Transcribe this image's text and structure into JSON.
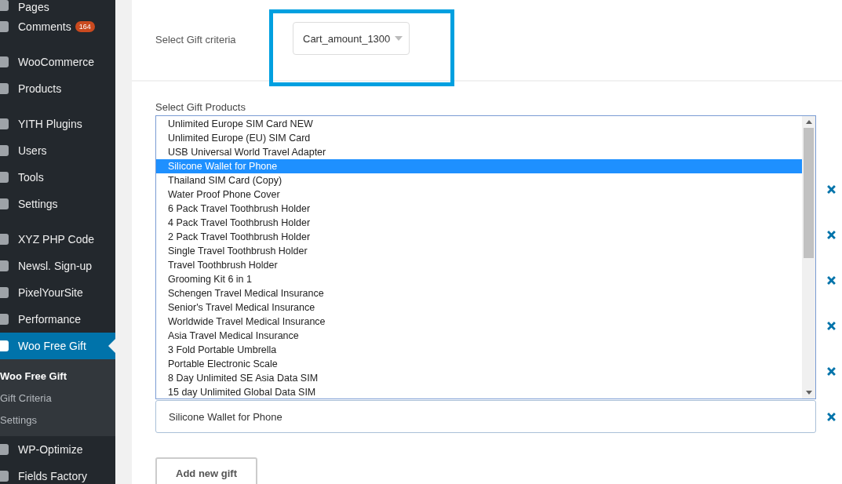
{
  "sidebar": {
    "groups": [
      {
        "items": [
          {
            "label": "Pages",
            "active": false
          },
          {
            "label": "Comments",
            "active": false,
            "badge": "164"
          }
        ]
      },
      {
        "items": [
          {
            "label": "WooCommerce",
            "active": false
          },
          {
            "label": "Products",
            "active": false
          }
        ]
      },
      {
        "items": [
          {
            "label": "YITH Plugins",
            "active": false
          },
          {
            "label": "Users",
            "active": false
          },
          {
            "label": "Tools",
            "active": false
          },
          {
            "label": "Settings",
            "active": false
          }
        ]
      },
      {
        "items": [
          {
            "label": "XYZ PHP Code",
            "active": false
          },
          {
            "label": "Newsl. Sign-up",
            "active": false
          },
          {
            "label": "PixelYourSite",
            "active": false
          },
          {
            "label": "Performance",
            "active": false
          },
          {
            "label": "Woo Free Gift",
            "selected": true,
            "submenu": [
              {
                "label": "Woo Free Gift",
                "selected": true
              },
              {
                "label": "Gift Criteria",
                "selected": false
              },
              {
                "label": "Settings",
                "selected": false
              }
            ]
          },
          {
            "label": "WP-Optimize",
            "active": false
          },
          {
            "label": "Fields Factory",
            "active": false
          }
        ]
      }
    ]
  },
  "criteria": {
    "label": "Select Gift criteria",
    "value": "Cart_amount_1300",
    "highlighted": true
  },
  "gifts": {
    "label": "Select Gift Products",
    "options": [
      {
        "label": "Unlimited Europe SIM Card NEW",
        "selected": false
      },
      {
        "label": "Unlimited Europe (EU) SIM Card",
        "selected": false
      },
      {
        "label": "USB Universal World Travel Adapter",
        "selected": false
      },
      {
        "label": "Silicone Wallet for Phone",
        "selected": true
      },
      {
        "label": "Thailand SIM Card (Copy)",
        "selected": false
      },
      {
        "label": "Water Proof Phone Cover",
        "selected": false
      },
      {
        "label": "6 Pack Travel Toothbrush Holder",
        "selected": false
      },
      {
        "label": "4 Pack Travel Toothbrush Holder",
        "selected": false
      },
      {
        "label": "2 Pack Travel Toothbrush Holder",
        "selected": false
      },
      {
        "label": "Single Travel Toothbrush Holder",
        "selected": false
      },
      {
        "label": "Travel Toothbrush Holder",
        "selected": false
      },
      {
        "label": "Grooming Kit 6 in 1",
        "selected": false
      },
      {
        "label": "Schengen Travel Medical Insurance",
        "selected": false
      },
      {
        "label": "Senior's Travel Medical Insurance",
        "selected": false
      },
      {
        "label": "Worldwide Travel Medical Insurance",
        "selected": false
      },
      {
        "label": "Asia Travel Medical Insurance",
        "selected": false
      },
      {
        "label": "3 Fold Portable Umbrella",
        "selected": false
      },
      {
        "label": "Portable Electronic Scale",
        "selected": false
      },
      {
        "label": "8 Day Unlimited SE Asia Data SIM",
        "selected": false
      },
      {
        "label": "15 day Unlimited Global Data SIM",
        "selected": false
      }
    ],
    "rows": [
      {
        "covered": true
      },
      {
        "covered": true
      },
      {
        "covered": true
      },
      {
        "covered": true
      },
      {
        "covered": true
      },
      {
        "covered": false,
        "value": "Silicone Wallet for Phone"
      }
    ],
    "add_button": "Add new gift"
  }
}
